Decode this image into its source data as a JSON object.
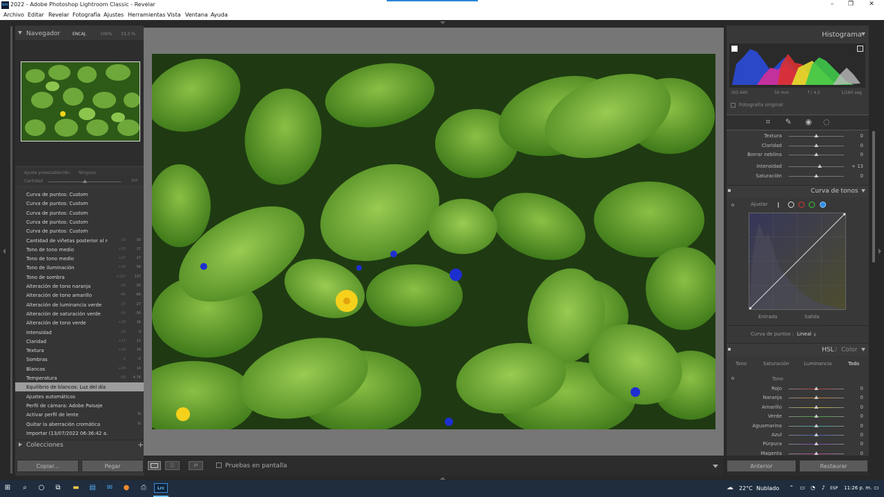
{
  "window": {
    "app_badge": "Lrc",
    "title": "2022 - Adobe Photoshop Lightroom Classic - Revelar",
    "minimize": "–",
    "restore": "❐",
    "close": "✕"
  },
  "menu": [
    "Archivo",
    "Editar",
    "Revelar",
    "Fotografía",
    "Ajustes",
    "Herramientas",
    "Vista",
    "Ventana",
    "Ayuda"
  ],
  "navigator": {
    "title": "Navegador",
    "zoom_options": [
      "ENCAJ.",
      "100%",
      "33,3 %"
    ]
  },
  "preset": {
    "label": "Ajuste preestablecido:",
    "value": "Ninguno",
    "amount_label": "Cantidad",
    "amount_value": "100"
  },
  "history": [
    {
      "label": "Curva de puntos: Custom",
      "v1": "",
      "v2": ""
    },
    {
      "label": "Curva de puntos: Custom",
      "v1": "",
      "v2": ""
    },
    {
      "label": "Curva de puntos: Custom",
      "v1": "",
      "v2": ""
    },
    {
      "label": "Curva de puntos: Custom",
      "v1": "",
      "v2": ""
    },
    {
      "label": "Curva de puntos: Custom",
      "v1": "",
      "v2": ""
    },
    {
      "label": "Cantidad de viñetas posterior al re...",
      "v1": "-10",
      "v2": "-30"
    },
    {
      "label": "Tono de tono medio",
      "v1": "+10",
      "v2": "17"
    },
    {
      "label": "Tono de tono medio",
      "v1": "+27",
      "v2": "27"
    },
    {
      "label": "Tono de iluminación",
      "v1": "+39",
      "v2": "56"
    },
    {
      "label": "Tono de sombra",
      "v1": "+137",
      "v2": "137"
    },
    {
      "label": "Alteración de tono naranja",
      "v1": "-35",
      "v2": "-35"
    },
    {
      "label": "Alteración de tono amarillo",
      "v1": "-66",
      "v2": "-66"
    },
    {
      "label": "Alteración de luminancia verde",
      "v1": "-27",
      "v2": "-27"
    },
    {
      "label": "Alteración de saturación verde",
      "v1": "-30",
      "v2": "-30"
    },
    {
      "label": "Alteración de tono verde",
      "v1": "+18",
      "v2": "18"
    },
    {
      "label": "Intensidad",
      "v1": "-11",
      "v2": "0"
    },
    {
      "label": "Claridad",
      "v1": "+11",
      "v2": "11"
    },
    {
      "label": "Textura",
      "v1": "+14",
      "v2": "14"
    },
    {
      "label": "Sombras",
      "v1": "-2",
      "v2": "-2"
    },
    {
      "label": "Blancos",
      "v1": "+24",
      "v2": "14"
    },
    {
      "label": "Temperatura",
      "v1": "-60",
      "v2": "4.7K"
    },
    {
      "label": "Equilibrio de blancos: Luz del día",
      "v1": "",
      "v2": "",
      "selected": true
    },
    {
      "label": "Ajustes automáticos",
      "v1": "",
      "v2": ""
    },
    {
      "label": "Perfil de cámara: Adobe Paisaje",
      "v1": "",
      "v2": ""
    },
    {
      "label": "Activar perfil de lente",
      "v1": "",
      "v2": "Sí"
    },
    {
      "label": "Quitar la aberración cromática",
      "v1": "",
      "v2": "Sí"
    },
    {
      "label": "Importar (13/07/2022 06:36:42 a. m.)",
      "v1": "",
      "v2": ""
    }
  ],
  "collections": {
    "title": "Colecciones",
    "add": "+"
  },
  "left_buttons": {
    "copy": "Copiar...",
    "paste": "Pegar"
  },
  "toolbar": {
    "soft_proof": "Pruebas en pantalla"
  },
  "histogram": {
    "title": "Histograma",
    "iso": "ISO 640",
    "focal": "50 mm",
    "aperture": "f / 4,5",
    "shutter": "1/160 seg",
    "original_photo": "Fotografía original"
  },
  "basic_sliders": [
    {
      "label": "Textura",
      "value": "0",
      "pos": 0.5
    },
    {
      "label": "Claridad",
      "value": "0",
      "pos": 0.5
    },
    {
      "label": "Borrar neblina",
      "value": "0",
      "pos": 0.5
    },
    {
      "label": "Intensidad",
      "value": "+ 13",
      "pos": 0.565
    },
    {
      "label": "Saturación",
      "value": "0",
      "pos": 0.5
    }
  ],
  "tone_curve": {
    "title": "Curva de tonos",
    "adjust": "Ajustar",
    "input": "Entrada",
    "output": "Salida",
    "point_curve_label": "Curva de puntos :",
    "point_curve_value": "Lineal"
  },
  "hsl": {
    "title": "HSL",
    "sep": "/",
    "color": "Color",
    "tabs": [
      "Tono",
      "Saturación",
      "Luminancia",
      "Todo"
    ],
    "section": "Tono",
    "sliders": [
      {
        "label": "Rojo",
        "value": "0",
        "color": "#c0393a"
      },
      {
        "label": "Naranja",
        "value": "0",
        "color": "#c87a2e"
      },
      {
        "label": "Amarillo",
        "value": "0",
        "color": "#c3b531"
      },
      {
        "label": "Verde",
        "value": "0",
        "color": "#4aa53e"
      },
      {
        "label": "Aguamarina",
        "value": "0",
        "color": "#3aa9a1"
      },
      {
        "label": "Azul",
        "value": "0",
        "color": "#3a5bc0"
      },
      {
        "label": "Púrpura",
        "value": "0",
        "color": "#7a45b8"
      },
      {
        "label": "Magenta",
        "value": "0",
        "color": "#c03aa0"
      }
    ]
  },
  "right_buttons": {
    "previous": "Anterior",
    "reset": "Restaurar"
  },
  "taskbar": {
    "app": "Lrc",
    "temperature": "22°C",
    "weather": "Nublado",
    "lang": "ESP",
    "time": "11:26 p. m."
  }
}
